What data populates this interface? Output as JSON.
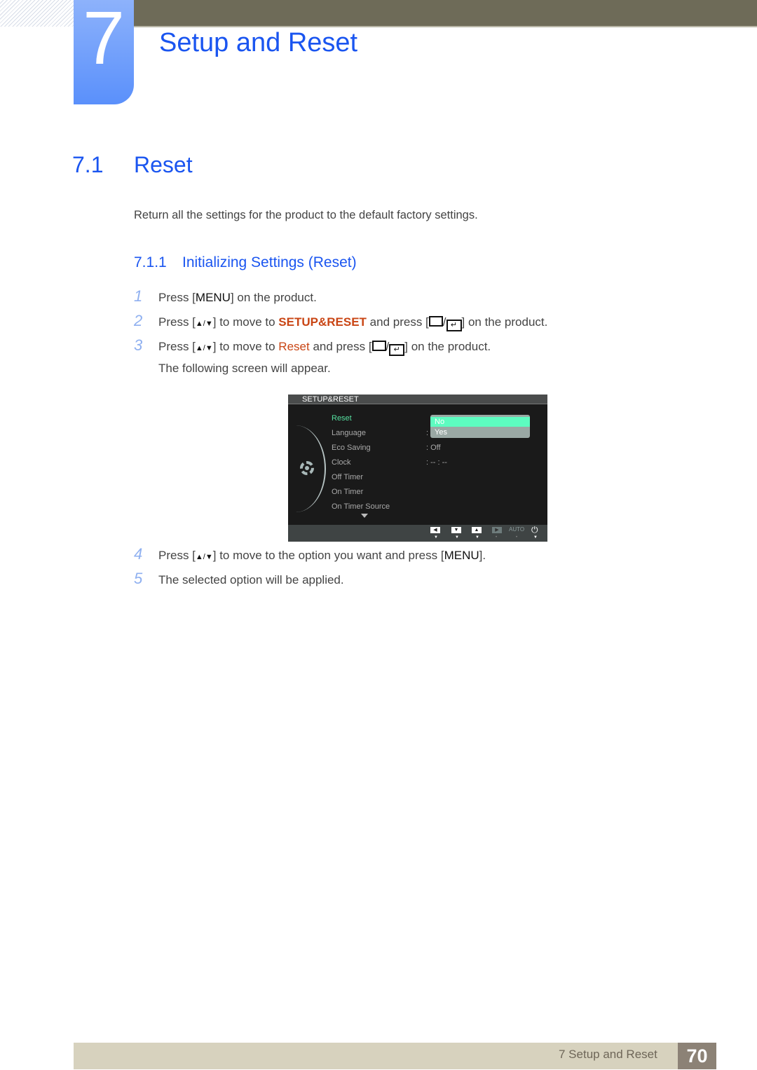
{
  "chapter": {
    "number": "7",
    "title": "Setup and Reset"
  },
  "section": {
    "number": "7.1",
    "title": "Reset",
    "intro": "Return all the settings for the product to the default factory settings."
  },
  "subsection": {
    "number": "7.1.1",
    "title": "Initializing Settings (Reset)"
  },
  "steps": [
    {
      "n": "1",
      "pre": "Press [",
      "key": "MENU",
      "post": "] on the product."
    },
    {
      "n": "2",
      "pre": "Press [",
      "keys": "▲/▼",
      "mid": "] to move to ",
      "highlight": "SETUP&RESET",
      "mid2": " and press [",
      "post": "] on the product."
    },
    {
      "n": "3",
      "pre": "Press [",
      "keys": "▲/▼",
      "mid": "] to move to ",
      "highlight": "Reset",
      "mid2": " and press [",
      "post": "] on the product."
    },
    {
      "note": "The following screen will appear."
    },
    {
      "n": "4",
      "pre": "Press [",
      "keys": "▲/▼",
      "mid": "] to move to the option you want and press [",
      "key": "MENU",
      "post": "]."
    },
    {
      "n": "5",
      "text": "The selected option will be applied."
    }
  ],
  "osd": {
    "header": "SETUP&RESET",
    "items": [
      "Reset",
      "Language",
      "Eco Saving",
      "Clock",
      "Off Timer",
      "On Timer",
      "On Timer Source"
    ],
    "values": {
      "language": ":",
      "eco_saving": ": Off",
      "clock": ":   -- : --"
    },
    "dropdown": {
      "selected": "No",
      "other": "Yes"
    },
    "buttons": {
      "left": "◀",
      "down": "▼",
      "up": "▲",
      "enter": "▶",
      "auto": "AUTO",
      "power": "⏻"
    },
    "colors": {
      "active": "#56e0a0",
      "selected_bg": "#5dfcc0"
    }
  },
  "footer": {
    "label": "7 Setup and Reset",
    "page": "70"
  },
  "colors": {
    "heading": "#1a55f0",
    "highlight": "#c94514",
    "step_number": "#8fb0f0"
  }
}
